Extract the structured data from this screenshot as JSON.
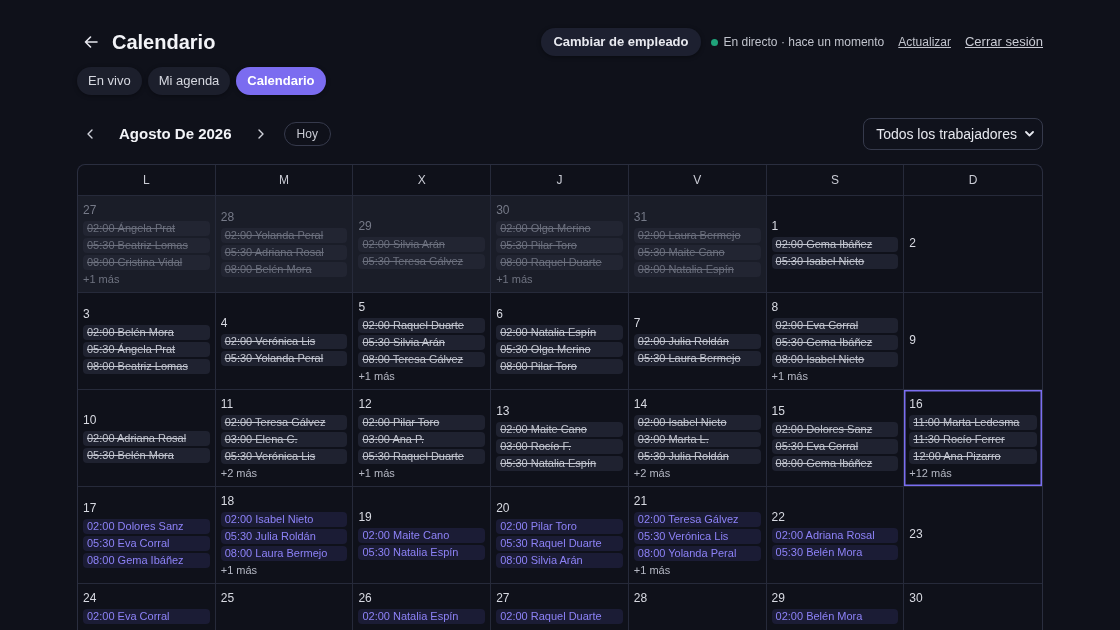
{
  "header": {
    "title": "Calendario"
  },
  "top_actions": {
    "switch_button": "Cambiar de empleado",
    "live_status": "En directo · hace un momento",
    "refresh_link": "Actualizar",
    "logout_link": "Cerrar sesión"
  },
  "tabs": [
    {
      "label": "En vivo",
      "selected": false
    },
    {
      "label": "Mi agenda",
      "selected": false
    },
    {
      "label": "Calendario",
      "selected": true
    }
  ],
  "month_nav": {
    "month": "Agosto De 2026",
    "today_button": "Hoy"
  },
  "worker_filter": {
    "value": "Todos los trabajadores"
  },
  "calendar": {
    "weekdays": [
      "L",
      "M",
      "X",
      "J",
      "V",
      "S",
      "D"
    ],
    "weeks": [
      {
        "days": [
          {
            "number": "27",
            "outside_month": true,
            "today": false,
            "events": [
              {
                "text": "02:00 Ángela Prat",
                "past": true
              },
              {
                "text": "05:30 Beatriz Lomas",
                "past": true
              },
              {
                "text": "08:00 Cristina Vidal",
                "past": true
              }
            ],
            "more": "+1 más"
          },
          {
            "number": "28",
            "outside_month": true,
            "today": false,
            "events": [
              {
                "text": "02:00 Yolanda Peral",
                "past": true
              },
              {
                "text": "05:30 Adriana Rosal",
                "past": true
              },
              {
                "text": "08:00 Belén Mora",
                "past": true
              }
            ]
          },
          {
            "number": "29",
            "outside_month": true,
            "today": false,
            "events": [
              {
                "text": "02:00 Silvia Arán",
                "past": true
              },
              {
                "text": "05:30 Teresa Gálvez",
                "past": true
              }
            ]
          },
          {
            "number": "30",
            "outside_month": true,
            "today": false,
            "events": [
              {
                "text": "02:00 Olga Merino",
                "past": true
              },
              {
                "text": "05:30 Pilar Toro",
                "past": true
              },
              {
                "text": "08:00 Raquel Duarte",
                "past": true
              }
            ],
            "more": "+1 más"
          },
          {
            "number": "31",
            "outside_month": true,
            "today": false,
            "events": [
              {
                "text": "02:00 Laura Bermejo",
                "past": true
              },
              {
                "text": "05:30 Maite Cano",
                "past": true
              },
              {
                "text": "08:00 Natalia Espín",
                "past": true
              }
            ]
          },
          {
            "number": "1",
            "outside_month": false,
            "today": false,
            "events": [
              {
                "text": "02:00 Gema Ibáñez",
                "past": true
              },
              {
                "text": "05:30 Isabel Nieto",
                "past": true
              }
            ]
          },
          {
            "number": "2",
            "outside_month": false,
            "today": false
          }
        ]
      },
      {
        "days": [
          {
            "number": "3",
            "outside_month": false,
            "today": false,
            "events": [
              {
                "text": "02:00 Belén Mora",
                "past": true
              },
              {
                "text": "05:30 Ángela Prat",
                "past": true
              },
              {
                "text": "08:00 Beatriz Lomas",
                "past": true
              }
            ]
          },
          {
            "number": "4",
            "outside_month": false,
            "today": false,
            "events": [
              {
                "text": "02:00 Verónica Lis",
                "past": true
              },
              {
                "text": "05:30 Yolanda Peral",
                "past": true
              }
            ]
          },
          {
            "number": "5",
            "outside_month": false,
            "today": false,
            "events": [
              {
                "text": "02:00 Raquel Duarte",
                "past": true
              },
              {
                "text": "05:30 Silvia Arán",
                "past": true
              },
              {
                "text": "08:00 Teresa Gálvez",
                "past": true
              }
            ],
            "more": "+1 más"
          },
          {
            "number": "6",
            "outside_month": false,
            "today": false,
            "events": [
              {
                "text": "02:00 Natalia Espín",
                "past": true
              },
              {
                "text": "05:30 Olga Merino",
                "past": true
              },
              {
                "text": "08:00 Pilar Toro",
                "past": true
              }
            ]
          },
          {
            "number": "7",
            "outside_month": false,
            "today": false,
            "events": [
              {
                "text": "02:00 Julia Roldán",
                "past": true
              },
              {
                "text": "05:30 Laura Bermejo",
                "past": true
              }
            ]
          },
          {
            "number": "8",
            "outside_month": false,
            "today": false,
            "events": [
              {
                "text": "02:00 Eva Corral",
                "past": true
              },
              {
                "text": "05:30 Gema Ibáñez",
                "past": true
              },
              {
                "text": "08:00 Isabel Nieto",
                "past": true
              }
            ],
            "more": "+1 más"
          },
          {
            "number": "9",
            "outside_month": false,
            "today": false
          }
        ]
      },
      {
        "days": [
          {
            "number": "10",
            "outside_month": false,
            "today": false,
            "events": [
              {
                "text": "02:00 Adriana Rosal",
                "past": true
              },
              {
                "text": "05:30 Belén Mora",
                "past": true
              }
            ]
          },
          {
            "number": "11",
            "outside_month": false,
            "today": false,
            "events": [
              {
                "text": "02:00 Teresa Gálvez",
                "past": true
              },
              {
                "text": "03:00 Elena C.",
                "past": true
              },
              {
                "text": "05:30 Verónica Lis",
                "past": true
              }
            ],
            "more": "+2 más"
          },
          {
            "number": "12",
            "outside_month": false,
            "today": false,
            "events": [
              {
                "text": "02:00 Pilar Toro",
                "past": true
              },
              {
                "text": "03:00 Ana P.",
                "past": true
              },
              {
                "text": "05:30 Raquel Duarte",
                "past": true
              }
            ],
            "more": "+1 más"
          },
          {
            "number": "13",
            "outside_month": false,
            "today": false,
            "events": [
              {
                "text": "02:00 Maite Cano",
                "past": true
              },
              {
                "text": "03:00 Rocío F.",
                "past": true
              },
              {
                "text": "05:30 Natalia Espín",
                "past": true
              }
            ]
          },
          {
            "number": "14",
            "outside_month": false,
            "today": false,
            "events": [
              {
                "text": "02:00 Isabel Nieto",
                "past": true
              },
              {
                "text": "03:00 Marta L.",
                "past": true
              },
              {
                "text": "05:30 Julia Roldán",
                "past": true
              }
            ],
            "more": "+2 más"
          },
          {
            "number": "15",
            "outside_month": false,
            "today": false,
            "events": [
              {
                "text": "02:00 Dolores Sanz",
                "past": true
              },
              {
                "text": "05:30 Eva Corral",
                "past": true
              },
              {
                "text": "08:00 Gema Ibáñez",
                "past": true
              }
            ]
          },
          {
            "number": "16",
            "outside_month": false,
            "today": true,
            "events": [
              {
                "text": "11:00 Marta Ledesma",
                "past": true
              },
              {
                "text": "11:30 Rocío Ferrer",
                "past": true
              },
              {
                "text": "12:00 Ana Pizarro",
                "past": true
              }
            ],
            "more": "+12 más"
          }
        ]
      },
      {
        "days": [
          {
            "number": "17",
            "outside_month": false,
            "today": false,
            "events": [
              {
                "text": "02:00 Dolores Sanz",
                "past": false
              },
              {
                "text": "05:30 Eva Corral",
                "past": false
              },
              {
                "text": "08:00 Gema Ibáñez",
                "past": false
              }
            ]
          },
          {
            "number": "18",
            "outside_month": false,
            "today": false,
            "events": [
              {
                "text": "02:00 Isabel Nieto",
                "past": false
              },
              {
                "text": "05:30 Julia Roldán",
                "past": false
              },
              {
                "text": "08:00 Laura Bermejo",
                "past": false
              }
            ],
            "more": "+1 más"
          },
          {
            "number": "19",
            "outside_month": false,
            "today": false,
            "events": [
              {
                "text": "02:00 Maite Cano",
                "past": false
              },
              {
                "text": "05:30 Natalia Espín",
                "past": false
              }
            ]
          },
          {
            "number": "20",
            "outside_month": false,
            "today": false,
            "events": [
              {
                "text": "02:00 Pilar Toro",
                "past": false
              },
              {
                "text": "05:30 Raquel Duarte",
                "past": false
              },
              {
                "text": "08:00 Silvia Arán",
                "past": false
              }
            ]
          },
          {
            "number": "21",
            "outside_month": false,
            "today": false,
            "events": [
              {
                "text": "02:00 Teresa Gálvez",
                "past": false
              },
              {
                "text": "05:30 Verónica Lis",
                "past": false
              },
              {
                "text": "08:00 Yolanda Peral",
                "past": false
              }
            ],
            "more": "+1 más"
          },
          {
            "number": "22",
            "outside_month": false,
            "today": false,
            "events": [
              {
                "text": "02:00 Adriana Rosal",
                "past": false
              },
              {
                "text": "05:30 Belén Mora",
                "past": false
              }
            ]
          },
          {
            "number": "23",
            "outside_month": false,
            "today": false
          }
        ]
      },
      {
        "days": [
          {
            "number": "24",
            "outside_month": false,
            "today": false,
            "events": [
              {
                "text": "02:00 Eva Corral",
                "past": false
              }
            ]
          },
          {
            "number": "25",
            "outside_month": false,
            "today": false
          },
          {
            "number": "26",
            "outside_month": false,
            "today": false,
            "events": [
              {
                "text": "02:00 Natalia Espín",
                "past": false
              }
            ]
          },
          {
            "number": "27",
            "outside_month": false,
            "today": false,
            "events": [
              {
                "text": "02:00 Raquel Duarte",
                "past": false
              }
            ]
          },
          {
            "number": "28",
            "outside_month": false,
            "today": false
          },
          {
            "number": "29",
            "outside_month": false,
            "today": false,
            "events": [
              {
                "text": "02:00 Belén Mora",
                "past": false
              }
            ]
          },
          {
            "number": "30",
            "outside_month": false,
            "today": false
          }
        ]
      }
    ]
  }
}
